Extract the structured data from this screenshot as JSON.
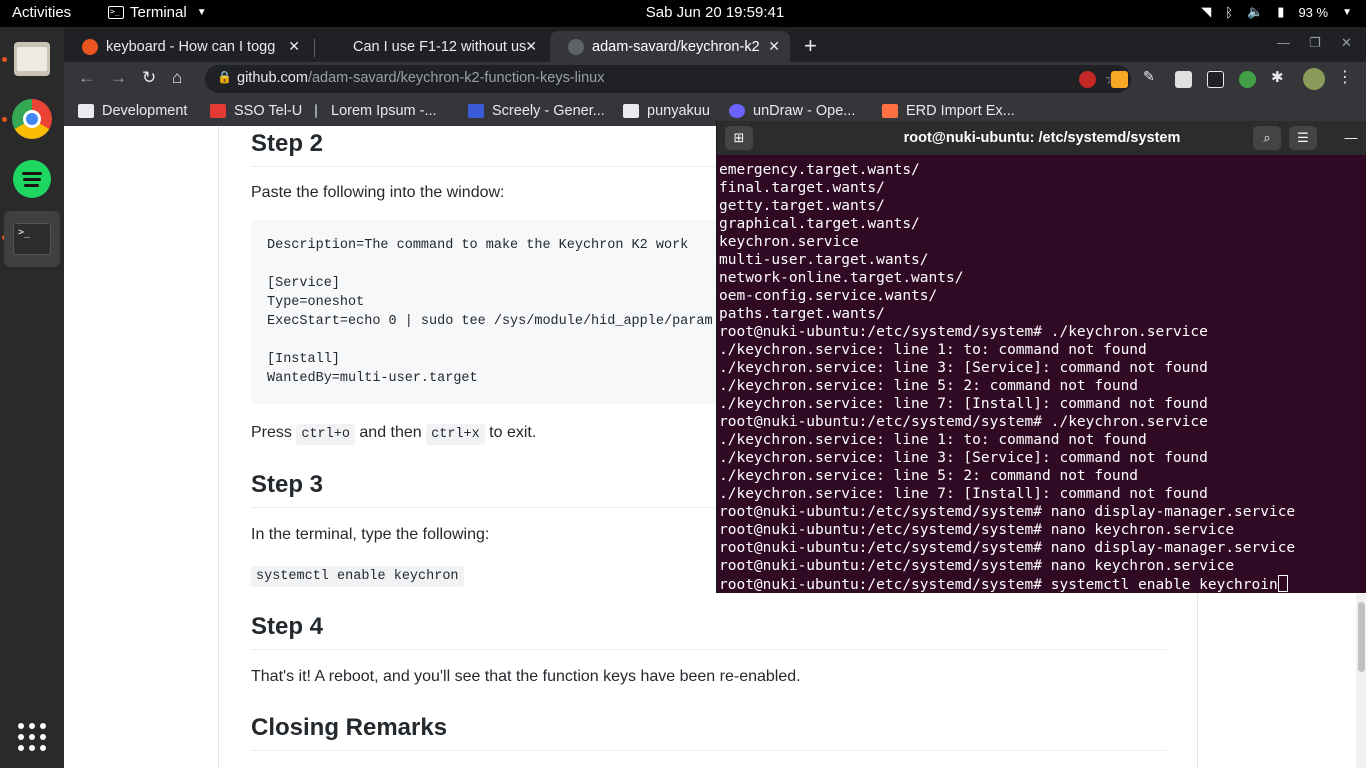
{
  "topbar": {
    "activities": "Activities",
    "app_name": "Terminal",
    "clock": "Sab Jun 20  19:59:41",
    "battery": "93 %"
  },
  "dock": {
    "items": [
      "files",
      "chrome",
      "spotify",
      "terminal"
    ]
  },
  "browser": {
    "tabs": [
      {
        "title": "keyboard - How can I togg",
        "favicon_color": "#e95420"
      },
      {
        "title": "Can I use F1-12 without us",
        "favicon_color": "#9aa0a6"
      },
      {
        "title": "adam-savard/keychron-k2",
        "favicon_color": "#5f6368"
      }
    ],
    "url_host": "github.com",
    "url_path": "/adam-savard/keychron-k2-function-keys-linux",
    "bookmarks": [
      {
        "label": "Development",
        "color": "#e8eaed"
      },
      {
        "label": "SSO Tel-U",
        "color": "#e53935"
      },
      {
        "label": "Lorem Ipsum -...",
        "color": "#9aa0a6"
      },
      {
        "label": "Screely - Gener...",
        "color": "#3b5bdb"
      },
      {
        "label": "punyakuu",
        "color": "#e8eaed"
      },
      {
        "label": "unDraw - Ope...",
        "color": "#6c63ff"
      },
      {
        "label": "ERD Import Ex...",
        "color": "#ff7043"
      }
    ]
  },
  "article": {
    "step2_heading": "Step 2",
    "step2_text": "Paste the following into the window:",
    "code_block": "Description=The command to make the Keychron K2 work\n\n[Service]\nType=oneshot\nExecStart=echo 0 | sudo tee /sys/module/hid_apple/param\n\n[Install]\nWantedBy=multi-user.target",
    "press_prefix": "Press ",
    "key1": "ctrl+o",
    "press_mid": " and then ",
    "key2": "ctrl+x",
    "press_suffix": " to exit.",
    "step3_heading": "Step 3",
    "step3_text": "In the terminal, type the following:",
    "step3_code": "systemctl enable keychron",
    "step4_heading": "Step 4",
    "step4_text": "That's it! A reboot, and you'll see that the function keys have been re-enabled.",
    "closing_heading": "Closing Remarks"
  },
  "terminal": {
    "title": "root@nuki-ubuntu: /etc/systemd/system",
    "lines": [
      "emergency.target.wants/",
      "final.target.wants/",
      "getty.target.wants/",
      "graphical.target.wants/",
      "keychron.service",
      "multi-user.target.wants/",
      "network-online.target.wants/",
      "oem-config.service.wants/",
      "paths.target.wants/",
      "root@nuki-ubuntu:/etc/systemd/system# ./keychron.service",
      "./keychron.service: line 1: to: command not found",
      "./keychron.service: line 3: [Service]: command not found",
      "./keychron.service: line 5: 2: command not found",
      "./keychron.service: line 7: [Install]: command not found",
      "root@nuki-ubuntu:/etc/systemd/system# ./keychron.service",
      "./keychron.service: line 1: to: command not found",
      "./keychron.service: line 3: [Service]: command not found",
      "./keychron.service: line 5: 2: command not found",
      "./keychron.service: line 7: [Install]: command not found",
      "root@nuki-ubuntu:/etc/systemd/system# nano display-manager.service",
      "root@nuki-ubuntu:/etc/systemd/system# nano keychron.service",
      "root@nuki-ubuntu:/etc/systemd/system# nano display-manager.service",
      "root@nuki-ubuntu:/etc/systemd/system# nano keychron.service"
    ],
    "prompt": "root@nuki-ubuntu:/etc/systemd/system# ",
    "current_input": "systemctl enable keychroin"
  }
}
